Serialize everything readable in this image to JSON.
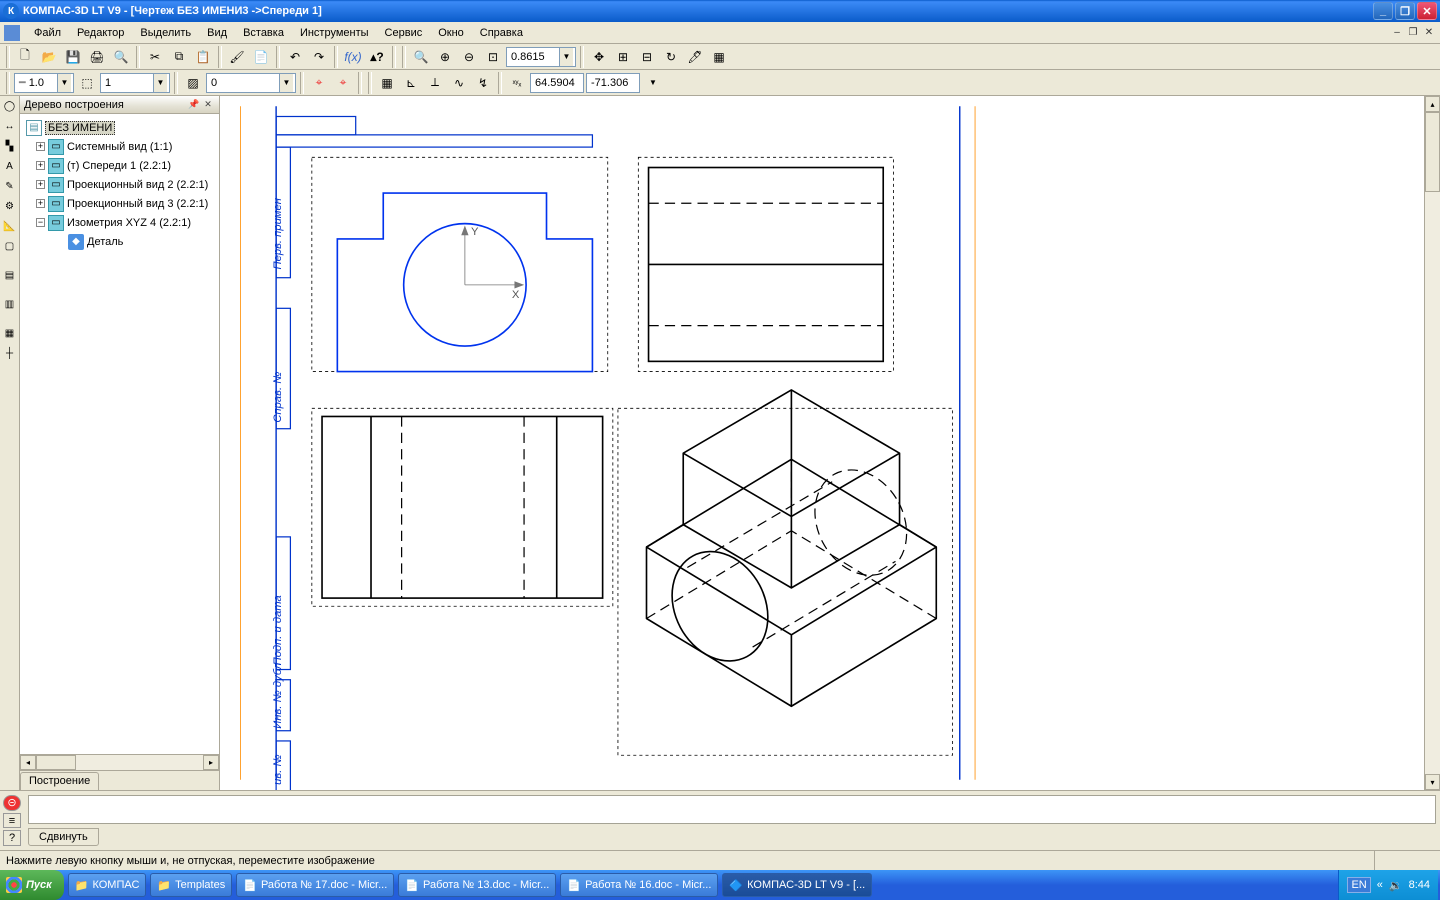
{
  "title": "КОМПАС-3D LT V9 - [Чертеж БЕЗ ИМЕНИ3 ->Спереди 1]",
  "menu": {
    "file": "Файл",
    "editor": "Редактор",
    "select": "Выделить",
    "view": "Вид",
    "insert": "Вставка",
    "tools": "Инструменты",
    "service": "Сервис",
    "window": "Окно",
    "help": "Справка"
  },
  "zoom_value": "0.8615",
  "line_width": "1.0",
  "layer_num": "1",
  "style_num": "0",
  "coord_x": "64.5904",
  "coord_y": "-71.306",
  "tree": {
    "title": "Дерево построения",
    "root": "БЕЗ ИМЕНИ",
    "items": [
      {
        "label": "Системный вид (1:1)"
      },
      {
        "label": "(т) Спереди 1 (2.2:1)"
      },
      {
        "label": "Проекционный вид 2 (2.2:1)"
      },
      {
        "label": "Проекционный вид 3 (2.2:1)"
      },
      {
        "label": "Изометрия XYZ 4 (2.2:1)"
      }
    ],
    "part_label": "Деталь",
    "tab": "Построение"
  },
  "cmd_tab": "Сдвинуть",
  "status": "Нажмите левую кнопку мыши и, не отпуская, переместите изображение",
  "taskbar": {
    "start": "Пуск",
    "tasks": [
      {
        "label": "КОМПАС",
        "type": "folder"
      },
      {
        "label": "Templates",
        "type": "folder"
      },
      {
        "label": "Работа № 17.doc - Micr...",
        "type": "doc"
      },
      {
        "label": "Работа № 13.doc - Micr...",
        "type": "doc"
      },
      {
        "label": "Работа № 16.doc - Micr...",
        "type": "doc"
      },
      {
        "label": "КОМПАС-3D LT V9 - [...",
        "type": "app",
        "active": true
      }
    ],
    "lang": "EN",
    "time": "8:44"
  }
}
